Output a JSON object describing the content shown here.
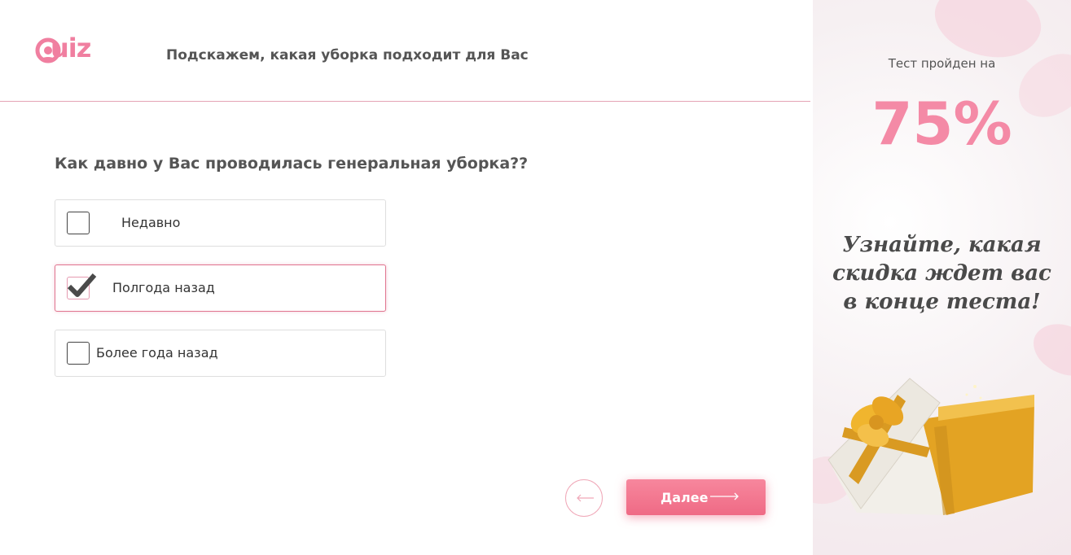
{
  "header": {
    "logo_text": "uiz",
    "title": "Подскажем, какая уборка подходит для Вас"
  },
  "question": {
    "text": "Как давно у Вас проводилась генеральная уборка??",
    "options": [
      {
        "label": "Недавно",
        "checked": false
      },
      {
        "label": "Полгода назад",
        "checked": true
      },
      {
        "label": "Более года назад",
        "checked": false
      }
    ]
  },
  "nav": {
    "back_icon": "arrow-left-icon",
    "next_label": "Далее",
    "next_icon": "arrow-right-icon"
  },
  "sidebar": {
    "progress_label": "Тест пройден на",
    "progress_value": "75%",
    "progress_fraction": 0.75,
    "promo_line1": "Узнайте, какая",
    "promo_line2": "скидка ждет вас",
    "promo_line3": "в конце теста!",
    "gift_icon": "gift-box-icon"
  },
  "colors": {
    "accent": "#ef6a85",
    "accent_light": "#f48aa6",
    "text": "#4a4a4a"
  }
}
